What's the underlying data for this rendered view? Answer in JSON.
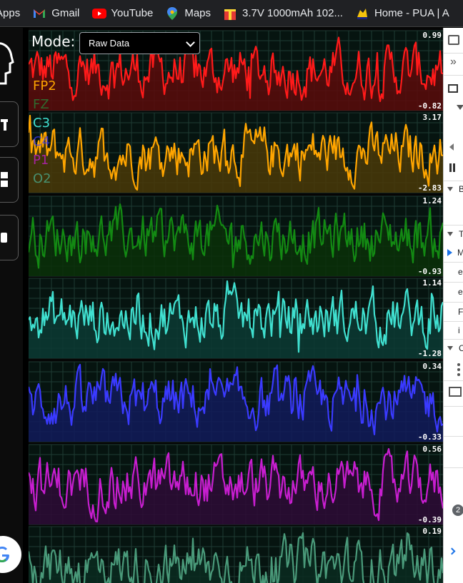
{
  "bookmarks": [
    {
      "label": "Apps",
      "icon": "apps-grid-icon"
    },
    {
      "label": "Gmail",
      "icon": "gmail-icon"
    },
    {
      "label": "YouTube",
      "icon": "youtube-icon"
    },
    {
      "label": "Maps",
      "icon": "maps-pin-icon"
    },
    {
      "label": "3.7V 1000mAh 102...",
      "icon": "gift-box-icon"
    },
    {
      "label": "Home - PUA | A",
      "icon": "pua-logo-icon"
    }
  ],
  "mode": {
    "label": "Mode:",
    "selected": "Raw Data"
  },
  "channel_labels_top": [
    "FP2",
    "FZ"
  ],
  "channel_labels_bottom": [
    "C3",
    "C4",
    "P1",
    "O2"
  ],
  "channels": [
    {
      "color": "#ff1a1a",
      "fill": "#5a0a0a",
      "max": "0.99",
      "min": "-0.82"
    },
    {
      "color": "#ffa500",
      "fill": "#4a3808",
      "max": "3.17",
      "min": "-2.83"
    },
    {
      "color": "#138a13",
      "fill": "#0a3008",
      "max": "1.24",
      "min": "-0.93"
    },
    {
      "color": "#40e0d0",
      "fill": "#0c3a34",
      "max": "1.14",
      "min": "-1.28"
    },
    {
      "color": "#3a3aff",
      "fill": "#121a5a",
      "max": "0.34",
      "min": "-0.33"
    },
    {
      "color": "#c81ed0",
      "fill": "#2e0a36",
      "max": "0.56",
      "min": "-0.39"
    },
    {
      "color": "#4a9a7a",
      "fill": "#0a2a20",
      "max": "0.19",
      "min": ""
    }
  ],
  "devtools": {
    "rows": [
      "B",
      "T",
      "M",
      "e",
      "e",
      "F",
      "i",
      "C"
    ],
    "badge": "2",
    "chevron": "»"
  }
}
